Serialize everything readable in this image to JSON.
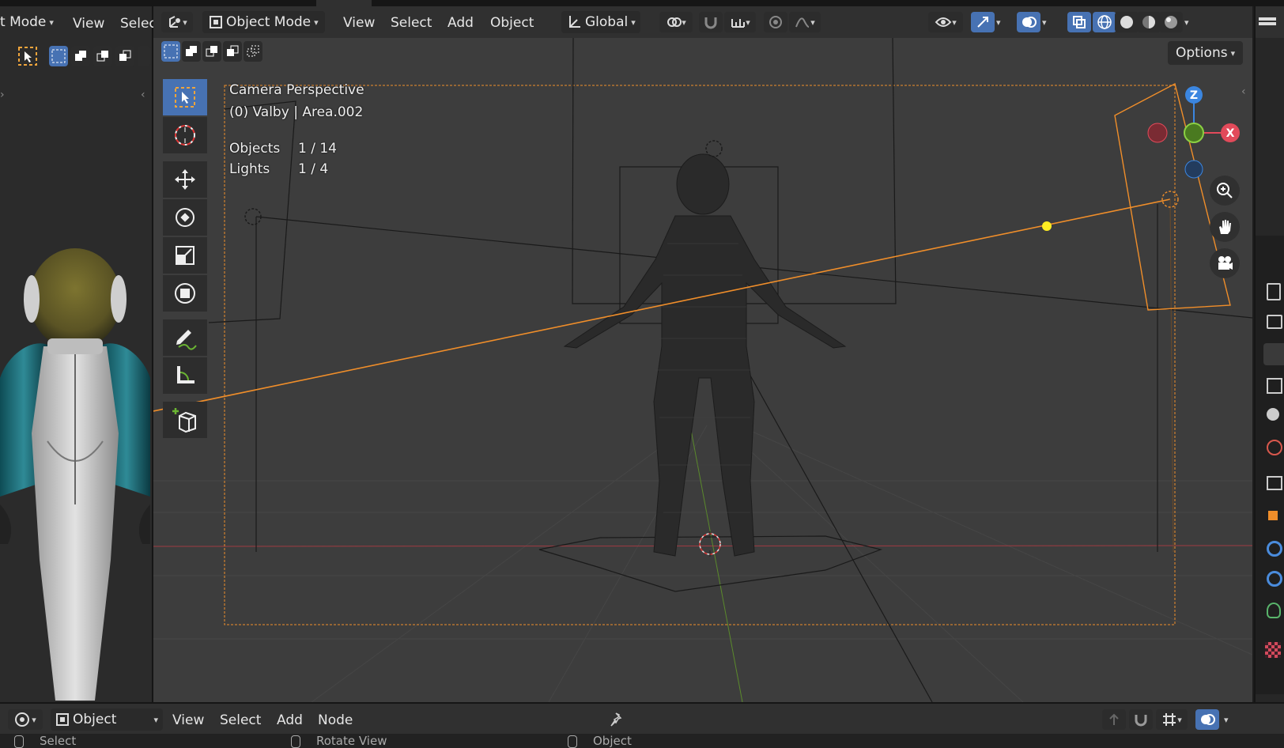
{
  "left_editor": {
    "mode_label": "t Mode",
    "menus": [
      "View",
      "Selec"
    ]
  },
  "viewport_header": {
    "mode_label": "Object Mode",
    "menus": [
      "View",
      "Select",
      "Add",
      "Object"
    ],
    "transform_orientation": "Global"
  },
  "options_label": "Options",
  "viewport_overlay": {
    "view_name": "Camera Perspective",
    "collection_line": "(0) Valby | Area.002",
    "stats": [
      {
        "label": "Objects",
        "value": "1 / 14"
      },
      {
        "label": "Lights",
        "value": "1 / 4"
      }
    ]
  },
  "gizmo": {
    "z_label": "Z",
    "x_label": "X"
  },
  "bottom_header": {
    "editor_type_label": "Object",
    "menus": [
      "View",
      "Select",
      "Add",
      "Node"
    ]
  },
  "status_bar": [
    "Select",
    "Rotate View",
    "Object"
  ],
  "colors": {
    "accent_blue": "#4772b3",
    "selection_orange": "#f08e2a",
    "light_yellow": "#ffee22",
    "axis_x_red": "#e24a5a",
    "axis_y_green": "#6bb533",
    "axis_z_blue": "#3b86e0"
  },
  "icons": {
    "tools": [
      "select-box-icon",
      "cursor-icon",
      "move-icon",
      "rotate-icon",
      "scale-icon",
      "transform-icon",
      "annotate-icon",
      "measure-icon",
      "add-cube-icon"
    ],
    "nav": [
      "zoom-icon",
      "pan-hand-icon",
      "camera-view-icon"
    ],
    "properties": [
      "tool-icon",
      "render-icon",
      "output-icon",
      "view-layer-icon",
      "scene-icon",
      "world-icon",
      "collection-icon",
      "object-icon",
      "modifier-icon",
      "physics-icon",
      "light-data-icon",
      "texture-icon"
    ]
  }
}
